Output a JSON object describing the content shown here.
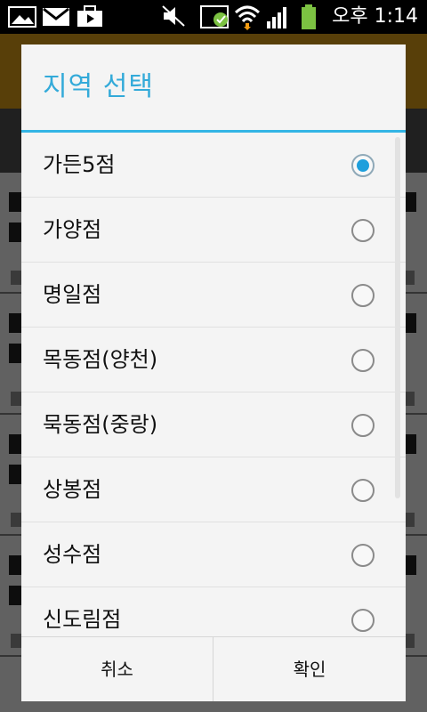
{
  "status_bar": {
    "time": "오후 1:14",
    "icons": [
      "gallery-icon",
      "gmail-icon",
      "briefcase-icon",
      "mute-icon",
      "usb-debug-icon",
      "wifi-icon",
      "signal-icon",
      "battery-icon"
    ]
  },
  "dialog": {
    "title": "지역 선택",
    "selected_index": 0,
    "items": [
      {
        "label": "가든5점",
        "selected": true
      },
      {
        "label": "가양점",
        "selected": false
      },
      {
        "label": "명일점",
        "selected": false
      },
      {
        "label": "목동점(양천)",
        "selected": false
      },
      {
        "label": "묵동점(중랑)",
        "selected": false
      },
      {
        "label": "상봉점",
        "selected": false
      },
      {
        "label": "성수점",
        "selected": false
      },
      {
        "label": "신도림점",
        "selected": false
      }
    ],
    "cancel_label": "취소",
    "ok_label": "확인"
  },
  "colors": {
    "accent": "#33b5e5",
    "title": "#33aad9",
    "radio_selected": "#1e9fdc",
    "app_header": "#e8a51a"
  }
}
